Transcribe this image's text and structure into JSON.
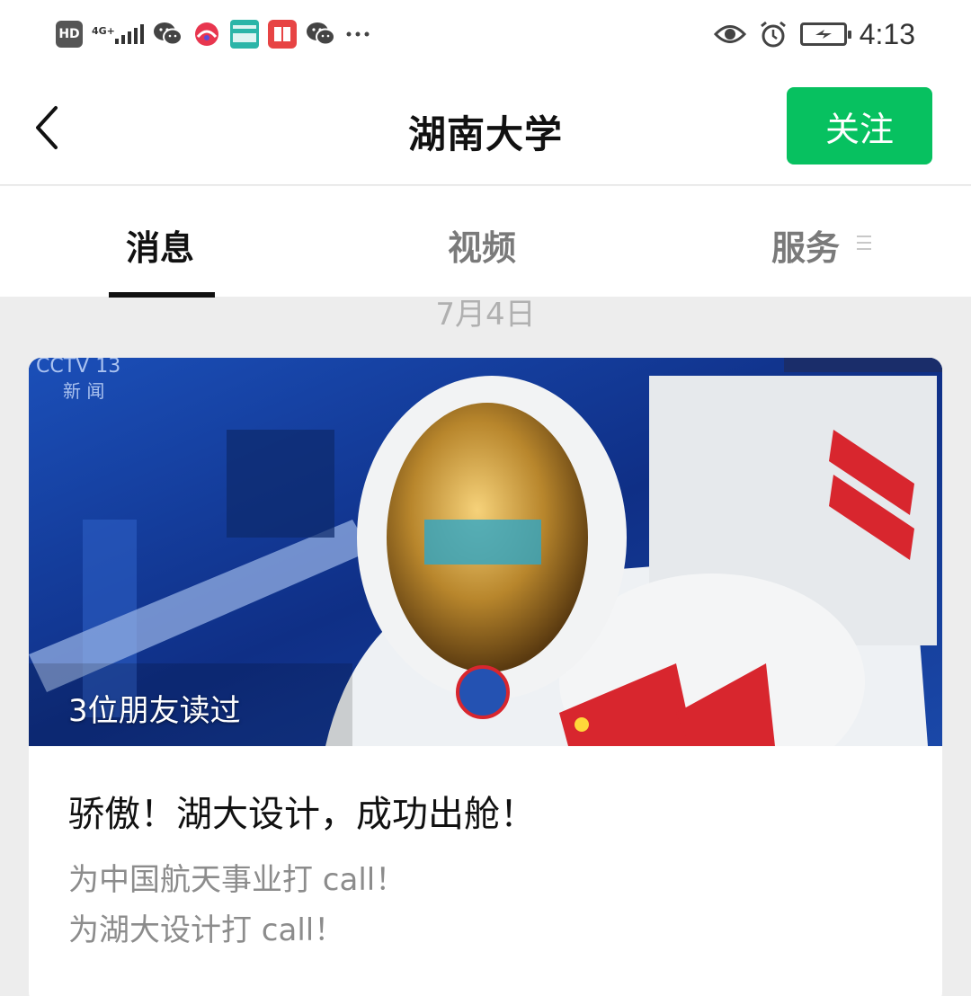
{
  "status_bar": {
    "network": "4G+",
    "time": "4:13",
    "left_icons": [
      "hd-icon",
      "signal-icon",
      "wechat-icon",
      "app-icon",
      "boss-zhipin-icon",
      "reader-icon",
      "wechat-icon",
      "more-dots-icon"
    ],
    "right_icons": [
      "eye-icon",
      "alarm-icon",
      "battery-charging-icon"
    ]
  },
  "header": {
    "title": "湖南大学",
    "follow_label": "关注"
  },
  "tabs": {
    "items": [
      {
        "label": "消息",
        "active": true
      },
      {
        "label": "视频",
        "active": false
      },
      {
        "label": "服务",
        "active": false
      }
    ]
  },
  "feed": {
    "date": "7月4日",
    "article": {
      "readers": "3位朋友读过",
      "title": "骄傲！湖大设计，成功出舱！",
      "desc_lines": [
        "为中国航天事业打 call！",
        "为湖大设计打 call！"
      ]
    }
  },
  "colors": {
    "accent": "#07c160",
    "background": "#ededed"
  }
}
